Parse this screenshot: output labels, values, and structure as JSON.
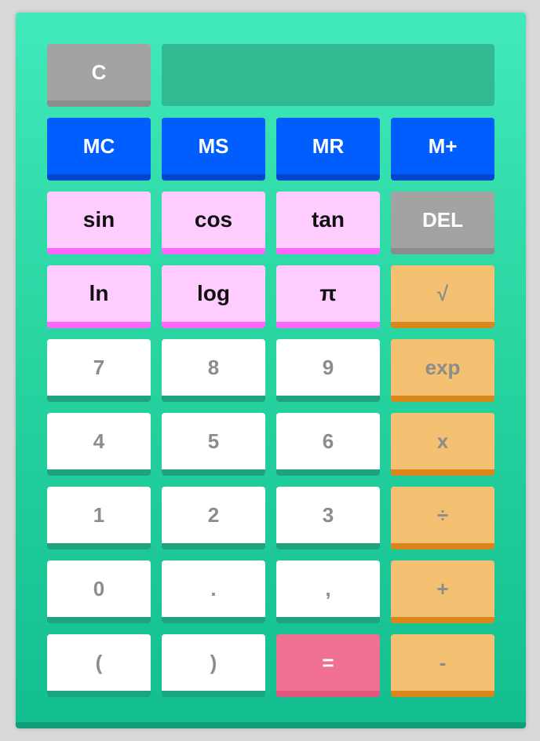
{
  "display": {
    "value": ""
  },
  "buttons": {
    "clear": "C",
    "mc": "MC",
    "ms": "MS",
    "mr": "MR",
    "mplus": "M+",
    "sin": "sin",
    "cos": "cos",
    "tan": "tan",
    "del": "DEL",
    "ln": "ln",
    "log": "log",
    "pi": "π",
    "sqrt": "√",
    "seven": "7",
    "eight": "8",
    "nine": "9",
    "exp": "exp",
    "four": "4",
    "five": "5",
    "six": "6",
    "multiply": "x",
    "one": "1",
    "two": "2",
    "three": "3",
    "divide": "÷",
    "zero": "0",
    "dot": ".",
    "comma": ",",
    "plus": "+",
    "open_paren": "(",
    "close_paren": ")",
    "equals": "=",
    "minus": "-"
  },
  "colors": {
    "body_top": "#42e9ba",
    "body_bottom": "#13bf8f",
    "display": "#33b991",
    "memory": "#005eff",
    "function": "#ffccff",
    "operator": "#f4c072",
    "clear": "#a3a3a3",
    "equals": "#f07094",
    "number": "#ffffff"
  }
}
